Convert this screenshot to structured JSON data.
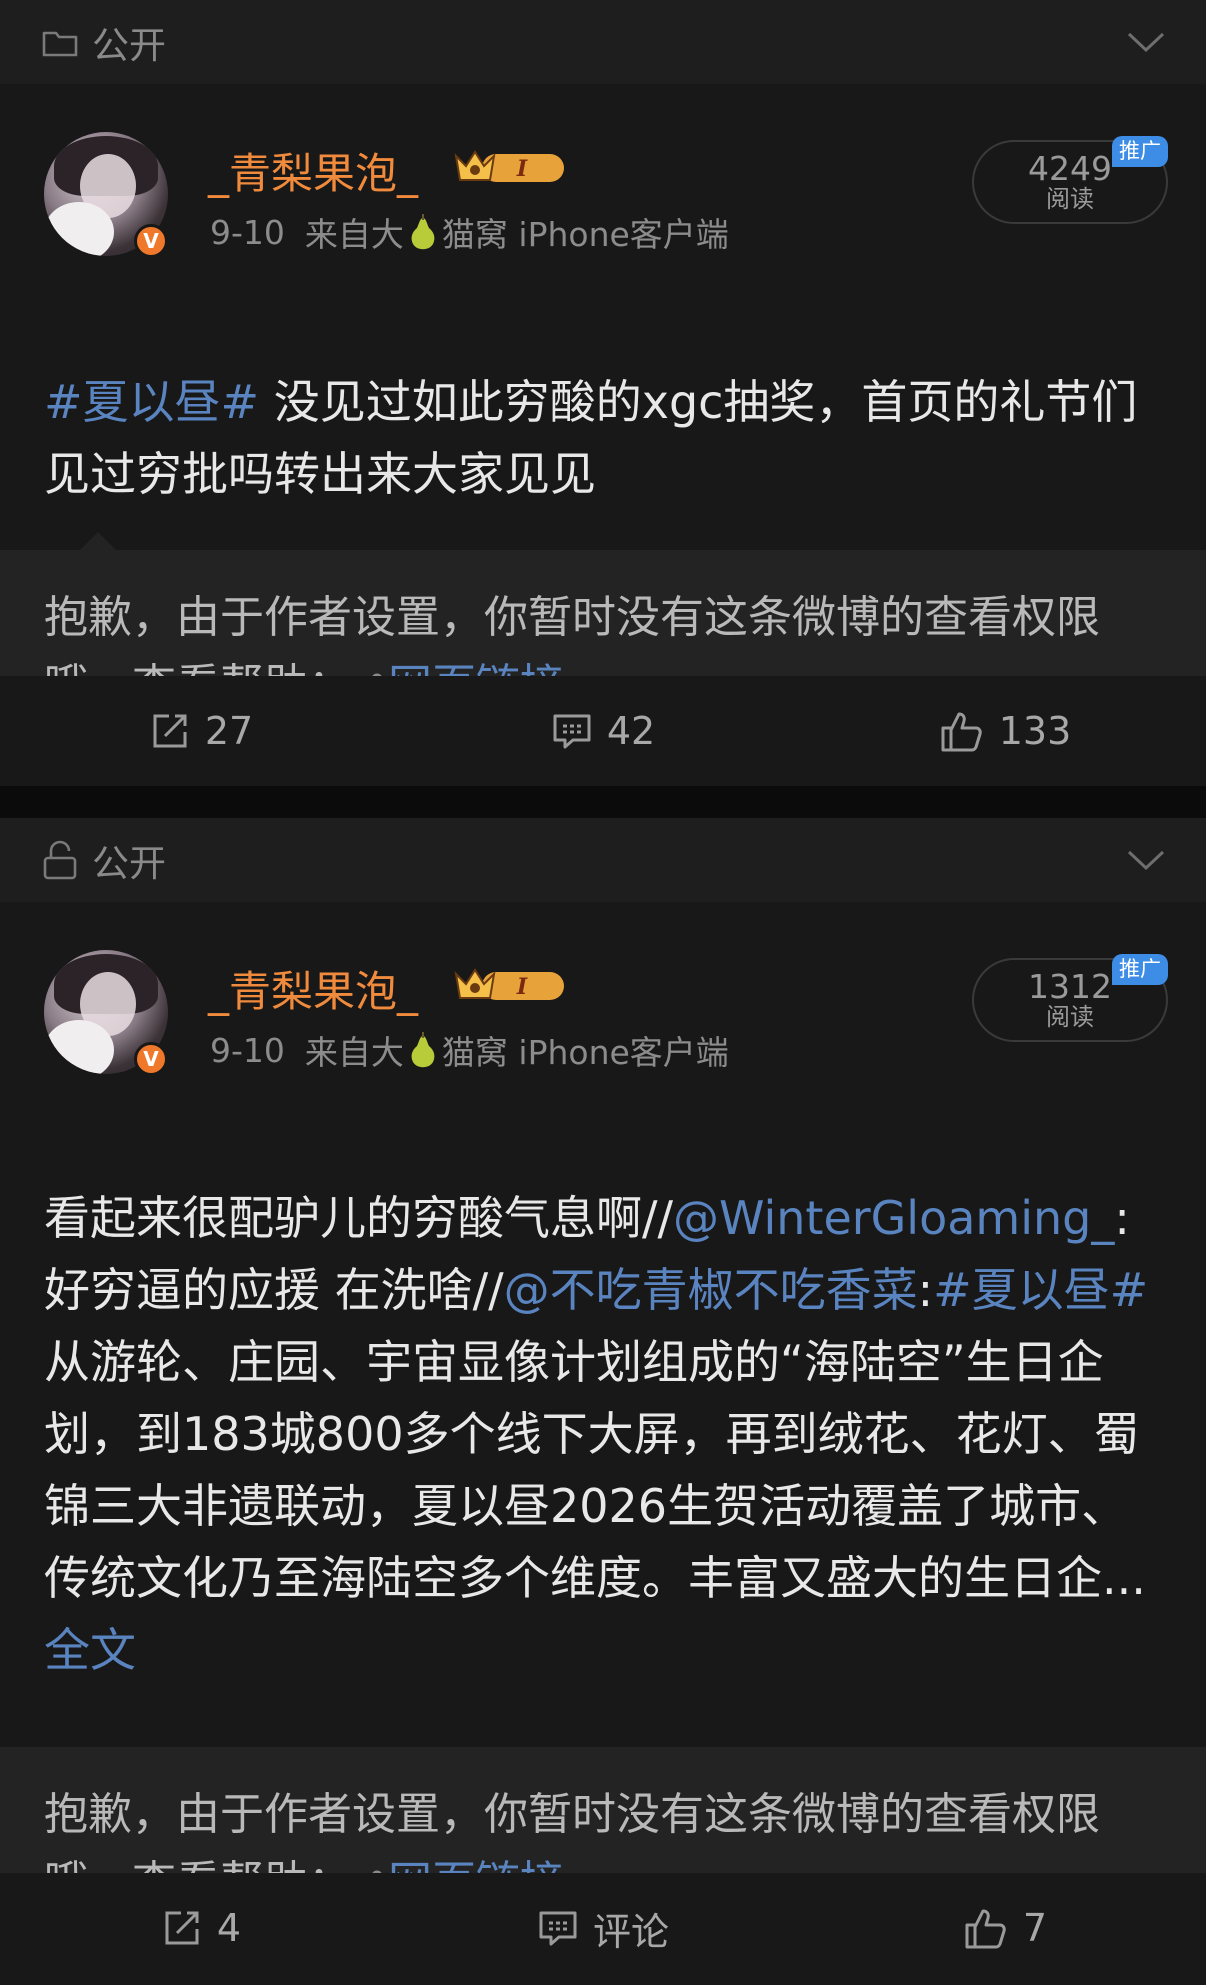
{
  "posts": [
    {
      "visibility": "公开",
      "username": "_青梨果泡_",
      "date": "9-10",
      "source_prefix": "来自大",
      "source_suffix": "猫窝 iPhone客户端",
      "reads": "4249",
      "reads_unit": "阅读",
      "promo": "推广",
      "text_tag": "#夏以昼#",
      "text": " 没见过如此穷酸的xgc抽奖，首页的礼节们见过穷批吗转出来大家见见",
      "notice": "抱歉，由于作者设置，你暂时没有这条微博的查看权限哦。查看帮助：",
      "notice_link": "网页链接",
      "repost": "27",
      "comment": "42",
      "like": "133"
    },
    {
      "visibility": "公开",
      "username": "_青梨果泡_",
      "date": "9-10",
      "source_prefix": "来自大",
      "source_suffix": "猫窝 iPhone客户端",
      "reads": "1312",
      "reads_unit": "阅读",
      "promo": "推广",
      "text_a": "看起来很配驴儿的穷酸气息啊//",
      "mention_1": "@WinterGloaming_",
      "text_b": ":好穷逼的应援 在洗啥//",
      "mention_2": "@不吃青椒不吃香菜",
      "text_c": ":",
      "text_tag": "#夏以昼#",
      "text_d": " 从游轮、庄园、宇宙显像计划组成的“海陆空”生日企划，到183城800多个线下大屏，再到绒花、花灯、蜀锦三大非遗联动，夏以昼2026生贺活动覆盖了城市、传统文化乃至海陆空多个维度。丰富又盛大的生日企...",
      "full_text": " 全文",
      "notice": "抱歉，由于作者设置，你暂时没有这条微博的查看权限哦。查看帮助：",
      "notice_link": "网页链接",
      "repost": "4",
      "comment": "评论",
      "like": "7"
    }
  ]
}
